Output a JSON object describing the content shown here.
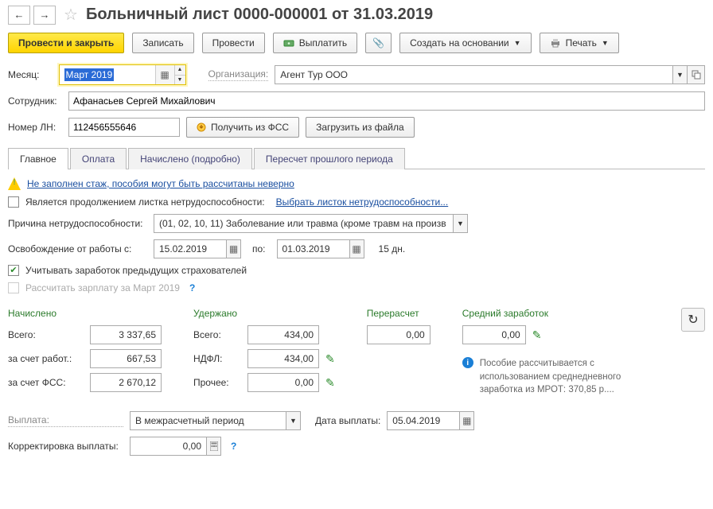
{
  "header": {
    "title": "Больничный лист 0000-000001 от 31.03.2019"
  },
  "toolbar": {
    "post_close": "Провести и закрыть",
    "save": "Записать",
    "post": "Провести",
    "pay": "Выплатить",
    "create_based": "Создать на основании",
    "print": "Печать"
  },
  "fields": {
    "month_label": "Месяц:",
    "month_value": "Март 2019",
    "org_label": "Организация:",
    "org_value": "Агент Тур ООО",
    "employee_label": "Сотрудник:",
    "employee_value": "Афанасьев Сергей Михайлович",
    "ln_label": "Номер ЛН:",
    "ln_value": "112456555646",
    "btn_fss": "Получить из ФСС",
    "btn_file": "Загрузить из файла"
  },
  "tabs": {
    "t1": "Главное",
    "t2": "Оплата",
    "t3": "Начислено (подробно)",
    "t4": "Пересчет прошлого периода"
  },
  "main": {
    "warning": "Не заполнен стаж, пособия могут быть рассчитаны неверно",
    "continuation_label": "Является продолжением листка нетрудоспособности:",
    "continuation_link": "Выбрать листок нетрудоспособности...",
    "reason_label": "Причина нетрудоспособности:",
    "reason_value": "(01, 02, 10, 11) Заболевание или травма (кроме травм на произв",
    "period_from_label": "Освобождение от работы с:",
    "period_from": "15.02.2019",
    "period_to_label": "по:",
    "period_to": "01.03.2019",
    "period_days": "15 дн.",
    "prev_insurers": "Учитывать заработок предыдущих страхователей",
    "recalc_salary": "Рассчитать зарплату за Март 2019"
  },
  "calc": {
    "accrued_head": "Начислено",
    "withheld_head": "Удержано",
    "recalc_head": "Перерасчет",
    "avg_head": "Средний заработок",
    "total_label": "Всего:",
    "employer_label": "за счет работ.:",
    "fss_label": "за счет ФСС:",
    "ndfl_label": "НДФЛ:",
    "other_label": "Прочее:",
    "accrued_total": "3 337,65",
    "accrued_employer": "667,53",
    "accrued_fss": "2 670,12",
    "withheld_total": "434,00",
    "withheld_ndfl": "434,00",
    "withheld_other": "0,00",
    "recalc_value": "0,00",
    "avg_value": "0,00",
    "info_text": "Пособие рассчитывается с использованием среднедневного заработка из МРОТ: 370,85 р...."
  },
  "payout": {
    "label": "Выплата:",
    "value": "В межрасчетный период",
    "date_label": "Дата выплаты:",
    "date_value": "05.04.2019",
    "correction_label": "Корректировка выплаты:",
    "correction_value": "0,00"
  }
}
